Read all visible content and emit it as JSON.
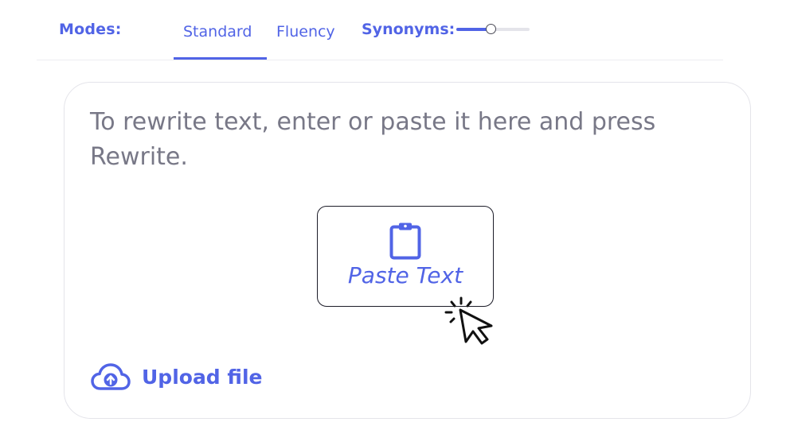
{
  "modes": {
    "label": "Modes:",
    "tabs": [
      {
        "label": "Standard",
        "active": true
      },
      {
        "label": "Fluency",
        "active": false
      }
    ],
    "synonyms": {
      "label": "Synonyms:",
      "level_percent": 48
    }
  },
  "editor": {
    "placeholder": "To rewrite text, enter or paste it here and press Rewrite.",
    "paste_button": {
      "label": "Paste Text",
      "icon": "clipboard-icon"
    },
    "cursor_icon": "pointer-click-icon",
    "upload": {
      "label": "Upload file",
      "icon": "cloud-upload-icon"
    }
  },
  "colors": {
    "accent": "#5164e6",
    "placeholder_text": "#787887",
    "border": "#e4e4ea",
    "dark": "#1c1c28"
  }
}
